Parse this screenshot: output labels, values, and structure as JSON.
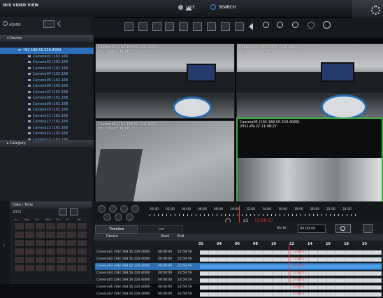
{
  "header": {
    "logo": "IRIS VIDEO VIEW",
    "user": "ADMIN",
    "modes": [
      {
        "label": "LIVE",
        "active": false
      },
      {
        "label": "SEARCH",
        "active": true
      }
    ]
  },
  "sidebar": {
    "device_title": "Device",
    "category_title": "Category",
    "items": [
      {
        "label": "192.168.50.220:4000",
        "selected": true
      },
      {
        "label": "Camera01 (192.168",
        "selected": false
      },
      {
        "label": "Camera02 (192.168",
        "selected": false
      },
      {
        "label": "Camera03 (192.168",
        "selected": false
      },
      {
        "label": "Camera04 (192.168",
        "selected": false
      },
      {
        "label": "Camera05 (192.168",
        "selected": false
      },
      {
        "label": "Camera06 (192.168",
        "selected": false
      },
      {
        "label": "Camera07 (192.168",
        "selected": false
      },
      {
        "label": "Camera08 (192.168",
        "selected": false
      },
      {
        "label": "Camera09 (192.168",
        "selected": false
      },
      {
        "label": "Camera10 (192.168",
        "selected": false
      },
      {
        "label": "Camera11 (192.168",
        "selected": false
      },
      {
        "label": "Camera12 (192.168",
        "selected": false
      },
      {
        "label": "Camera13 (192.168",
        "selected": false
      },
      {
        "label": "Camera14 (192.168",
        "selected": false
      },
      {
        "label": "Camera15 (192.168",
        "selected": false
      }
    ]
  },
  "cameras": [
    {
      "label": "Camera01 (192.168.50.220:4000)",
      "time": "2011-09-22 11:08:27"
    },
    {
      "label": "Camera02 (192.168.50.220:4000)",
      "time": "2011-09-22 11:08:27"
    },
    {
      "label": "Camera03 (192.168.50.220:4000)",
      "time": "2011-09-22 11:08:27"
    },
    {
      "label": "Camera05 (192.168.50.220:4000)",
      "time": "2011-09-22 11:08:27"
    }
  ],
  "datetime_panel": {
    "title": "Date / Time",
    "year": "2011",
    "weekdays": [
      "Sun",
      "Mon",
      "Tue",
      "Wed",
      "Thu",
      "Fri",
      "Sat"
    ]
  },
  "playback": {
    "hours": [
      "00:00",
      "02:00",
      "04:00",
      "06:00",
      "08:00",
      "10:00",
      "12:00",
      "14:00",
      "16:00",
      "18:00",
      "20:00",
      "22:00",
      "24:00"
    ],
    "speed": "x1",
    "current_time": "11:08:27",
    "goto_label": "Go to",
    "goto_time": "00:00:00"
  },
  "timeline": {
    "tabs": [
      "Timeline",
      "List"
    ],
    "columns": [
      "Device",
      "Start",
      "End"
    ],
    "hour_marks": [
      "02",
      "04",
      "06",
      "08",
      "10",
      "12",
      "14",
      "16",
      "18",
      "20"
    ],
    "marker_time": "11:08:27",
    "rows": [
      {
        "device": "Camera01 (192.168.50.220:4000)",
        "start": "00:00:00",
        "end": "23:59:59",
        "highlight": false
      },
      {
        "device": "Camera02 (192.168.50.220:4000)",
        "start": "00:00:00",
        "end": "23:59:59",
        "highlight": false
      },
      {
        "device": "Camera03 (192.168.50.220:4000)",
        "start": "00:00:00",
        "end": "23:59:59",
        "highlight": true
      },
      {
        "device": "Camera04 (192.168.50.220:4000)",
        "start": "00:00:00",
        "end": "23:59:59",
        "highlight": false
      },
      {
        "device": "Camera05 (192.168.50.220:4000)",
        "start": "00:00:00",
        "end": "23:59:59",
        "highlight": false
      },
      {
        "device": "Camera06 (192.168.50.220:4000)",
        "start": "00:00:00",
        "end": "23:59:59",
        "highlight": false
      },
      {
        "device": "Camera07 (192.168.50.220:4000)",
        "start": "00:00:00",
        "end": "23:59:59",
        "highlight": false
      }
    ]
  },
  "colors": {
    "accent_blue": "#2c6fb8",
    "timeline_marker": "#e23b3b",
    "selected_camera_border": "#3fae3f"
  }
}
